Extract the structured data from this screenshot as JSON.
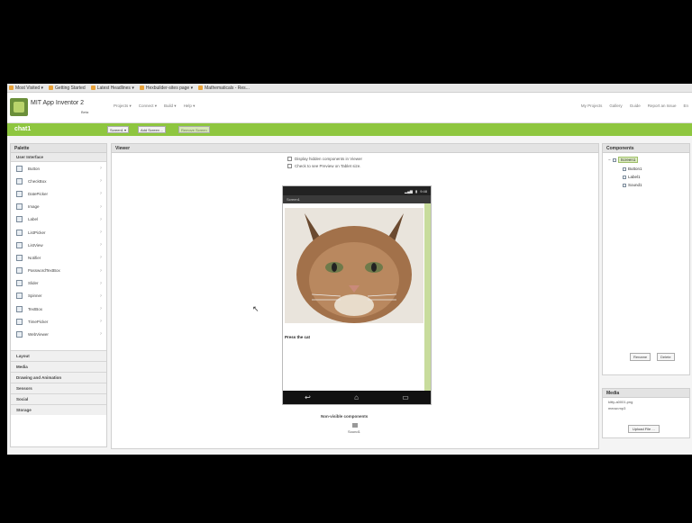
{
  "bookmarks": [
    {
      "label": "Most Visited ▾"
    },
    {
      "label": "Getting Started"
    },
    {
      "label": "Latest Headlines ▾"
    },
    {
      "label": "Hexbuilder-sites page ▾"
    },
    {
      "label": "Mathematicals - Res..."
    }
  ],
  "header": {
    "brand": "MIT App Inventor 2",
    "beta": "Beta",
    "menu": [
      "Projects ▾",
      "Connect ▾",
      "Build ▾",
      "Help ▾"
    ],
    "right_menu": [
      "My Projects",
      "Gallery",
      "Guide",
      "Report an Issue",
      "En"
    ]
  },
  "greenbar": {
    "project_name": "chat1",
    "buttons": [
      "Screen1 ▾",
      "Add Screen ...",
      "Remove Screen"
    ]
  },
  "palette": {
    "title": "Palette",
    "category": "User Interface",
    "items": [
      {
        "label": "Button"
      },
      {
        "label": "CheckBox"
      },
      {
        "label": "DatePicker"
      },
      {
        "label": "Image"
      },
      {
        "label": "Label"
      },
      {
        "label": "ListPicker"
      },
      {
        "label": "ListView"
      },
      {
        "label": "Notifier"
      },
      {
        "label": "PasswordTextBox"
      },
      {
        "label": "Slider"
      },
      {
        "label": "Spinner"
      },
      {
        "label": "TextBox"
      },
      {
        "label": "TimePicker"
      },
      {
        "label": "WebViewer"
      }
    ],
    "drawers": [
      "Layout",
      "Media",
      "Drawing and Animation",
      "Sensors",
      "Social",
      "Storage"
    ]
  },
  "viewer": {
    "title": "Viewer",
    "check1": "Display hidden components in Viewer",
    "check2": "Check to see Preview on Tablet size.",
    "status_time": "9:48",
    "screen_title": "Screen1",
    "label_text": "Press the cat",
    "nonvisible_title": "Non-visible components",
    "nonvisible_item": "Sound1"
  },
  "components": {
    "title": "Components",
    "root": "Screen1",
    "children": [
      "Button1",
      "Label1",
      "Sound1"
    ],
    "rename": "Rename",
    "delete": "Delete"
  },
  "media": {
    "title": "Media",
    "files": [
      "kitty-a0001.png",
      "meow.mp3"
    ],
    "upload": "Upload File ..."
  },
  "colors": {
    "green_bar": "#8ec63f",
    "panel_head": "#e3e3e3"
  }
}
